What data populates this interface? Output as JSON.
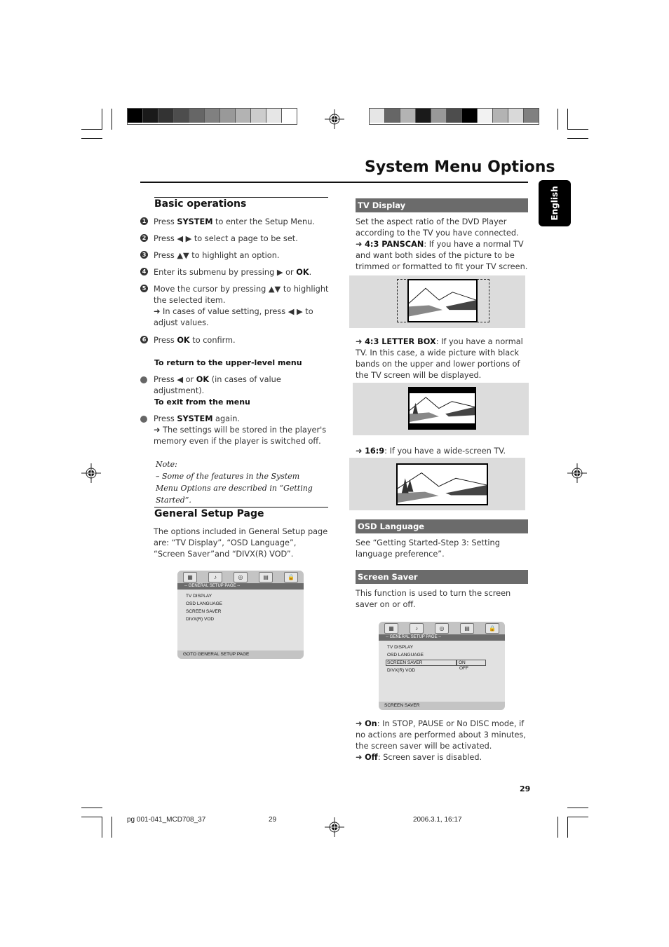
{
  "header": {
    "title": "System Menu Options",
    "language_tab": "English"
  },
  "color_strip_left": [
    "#000000",
    "#1a1a1a",
    "#333333",
    "#4d4d4d",
    "#666666",
    "#808080",
    "#999999",
    "#b3b3b3",
    "#cccccc",
    "#e6e6e6",
    "#ffffff"
  ],
  "color_strip_right": [
    "#e6e6e6",
    "#666666",
    "#b3b3b3",
    "#1a1a1a",
    "#999999",
    "#4d4d4d",
    "#000000",
    "#f2f2f2",
    "#b3b3b3",
    "#d9d9d9",
    "#808080"
  ],
  "basic_operations": {
    "heading": "Basic operations",
    "steps": [
      {
        "num": "1",
        "text_html": "Press <b>SYSTEM</b> to enter the Setup Menu."
      },
      {
        "num": "2",
        "text_html": "Press ◀ ▶ to select a page to be set."
      },
      {
        "num": "3",
        "text_html": "Press ▲▼ to highlight an option."
      },
      {
        "num": "4",
        "text_html": "Enter its submenu by pressing ▶ or <b>OK</b>."
      },
      {
        "num": "5",
        "text_html": "Move the cursor by pressing ▲▼ to highlight the selected item.<br>➜ In cases of value setting, press ◀ ▶ to adjust values."
      },
      {
        "num": "6",
        "text_html": "Press <b>OK</b> to confirm."
      }
    ],
    "return_heading": "To return to the upper-level menu",
    "return_text_html": "Press ◀ or <b>OK</b> (in cases of value adjustment).",
    "exit_heading": "To exit from the menu",
    "exit_text_html": "Press <b>SYSTEM</b> again.<br>➜ The settings will be stored in the player's memory even if the player is switched off.",
    "note_label": "Note:",
    "note_text": "–  Some of the features in the System Menu Options are described in “Getting Started”."
  },
  "general_setup": {
    "heading": "General Setup Page",
    "intro": "The options included in General Setup page are: “TV Display”, “OSD Language”, “Screen Saver”and  “DIVX(R) VOD”.",
    "menu": {
      "page_header": "-- GENERAL SETUP PAGE --",
      "items": [
        "TV DISPLAY",
        "OSD LANGUAGE",
        "SCREEN SAVER",
        "DIVX(R) VOD"
      ],
      "footer": "GOTO GENERAL SETUP PAGE"
    }
  },
  "tv_display": {
    "heading": "TV Display",
    "intro": "Set the aspect ratio of the DVD Player according to the TV you have connected.",
    "panscan_html": "➜ <b>4:3 PANSCAN</b>: If you have a normal TV and want both sides of the picture to be trimmed or formatted to fit your TV screen.",
    "letterbox_html": "➜ <b>4:3 LETTER BOX</b>: If you have a normal TV. In this case, a wide picture with black bands on the upper and lower portions of the TV screen will be displayed.",
    "widescreen_html": "➜ <b>16:9</b>: If you have a wide-screen TV."
  },
  "osd_language": {
    "heading": "OSD Language",
    "text": "See “Getting Started-Step 3: Setting language preference”."
  },
  "screen_saver": {
    "heading": "Screen Saver",
    "text": "This function is used to turn the screen saver on or off.",
    "menu": {
      "page_header": "-- GENERAL SETUP PAGE --",
      "items": [
        "TV DISPLAY",
        "OSD LANGUAGE",
        "SCREEN SAVER",
        "DIVX(R) VOD"
      ],
      "options": [
        "ON",
        "OFF"
      ],
      "footer": "SCREEN SAVER"
    },
    "on_html": "➜ <b>On</b>: In STOP, PAUSE or No DISC mode, if no actions are performed about 3 minutes, the screen saver will be activated.",
    "off_html": "➜ <b>Off</b>: Screen saver is disabled."
  },
  "page_number": "29",
  "print_footer": {
    "file": "pg 001-041_MCD708_37",
    "page": "29",
    "date": "2006.3.1, 16:17"
  }
}
